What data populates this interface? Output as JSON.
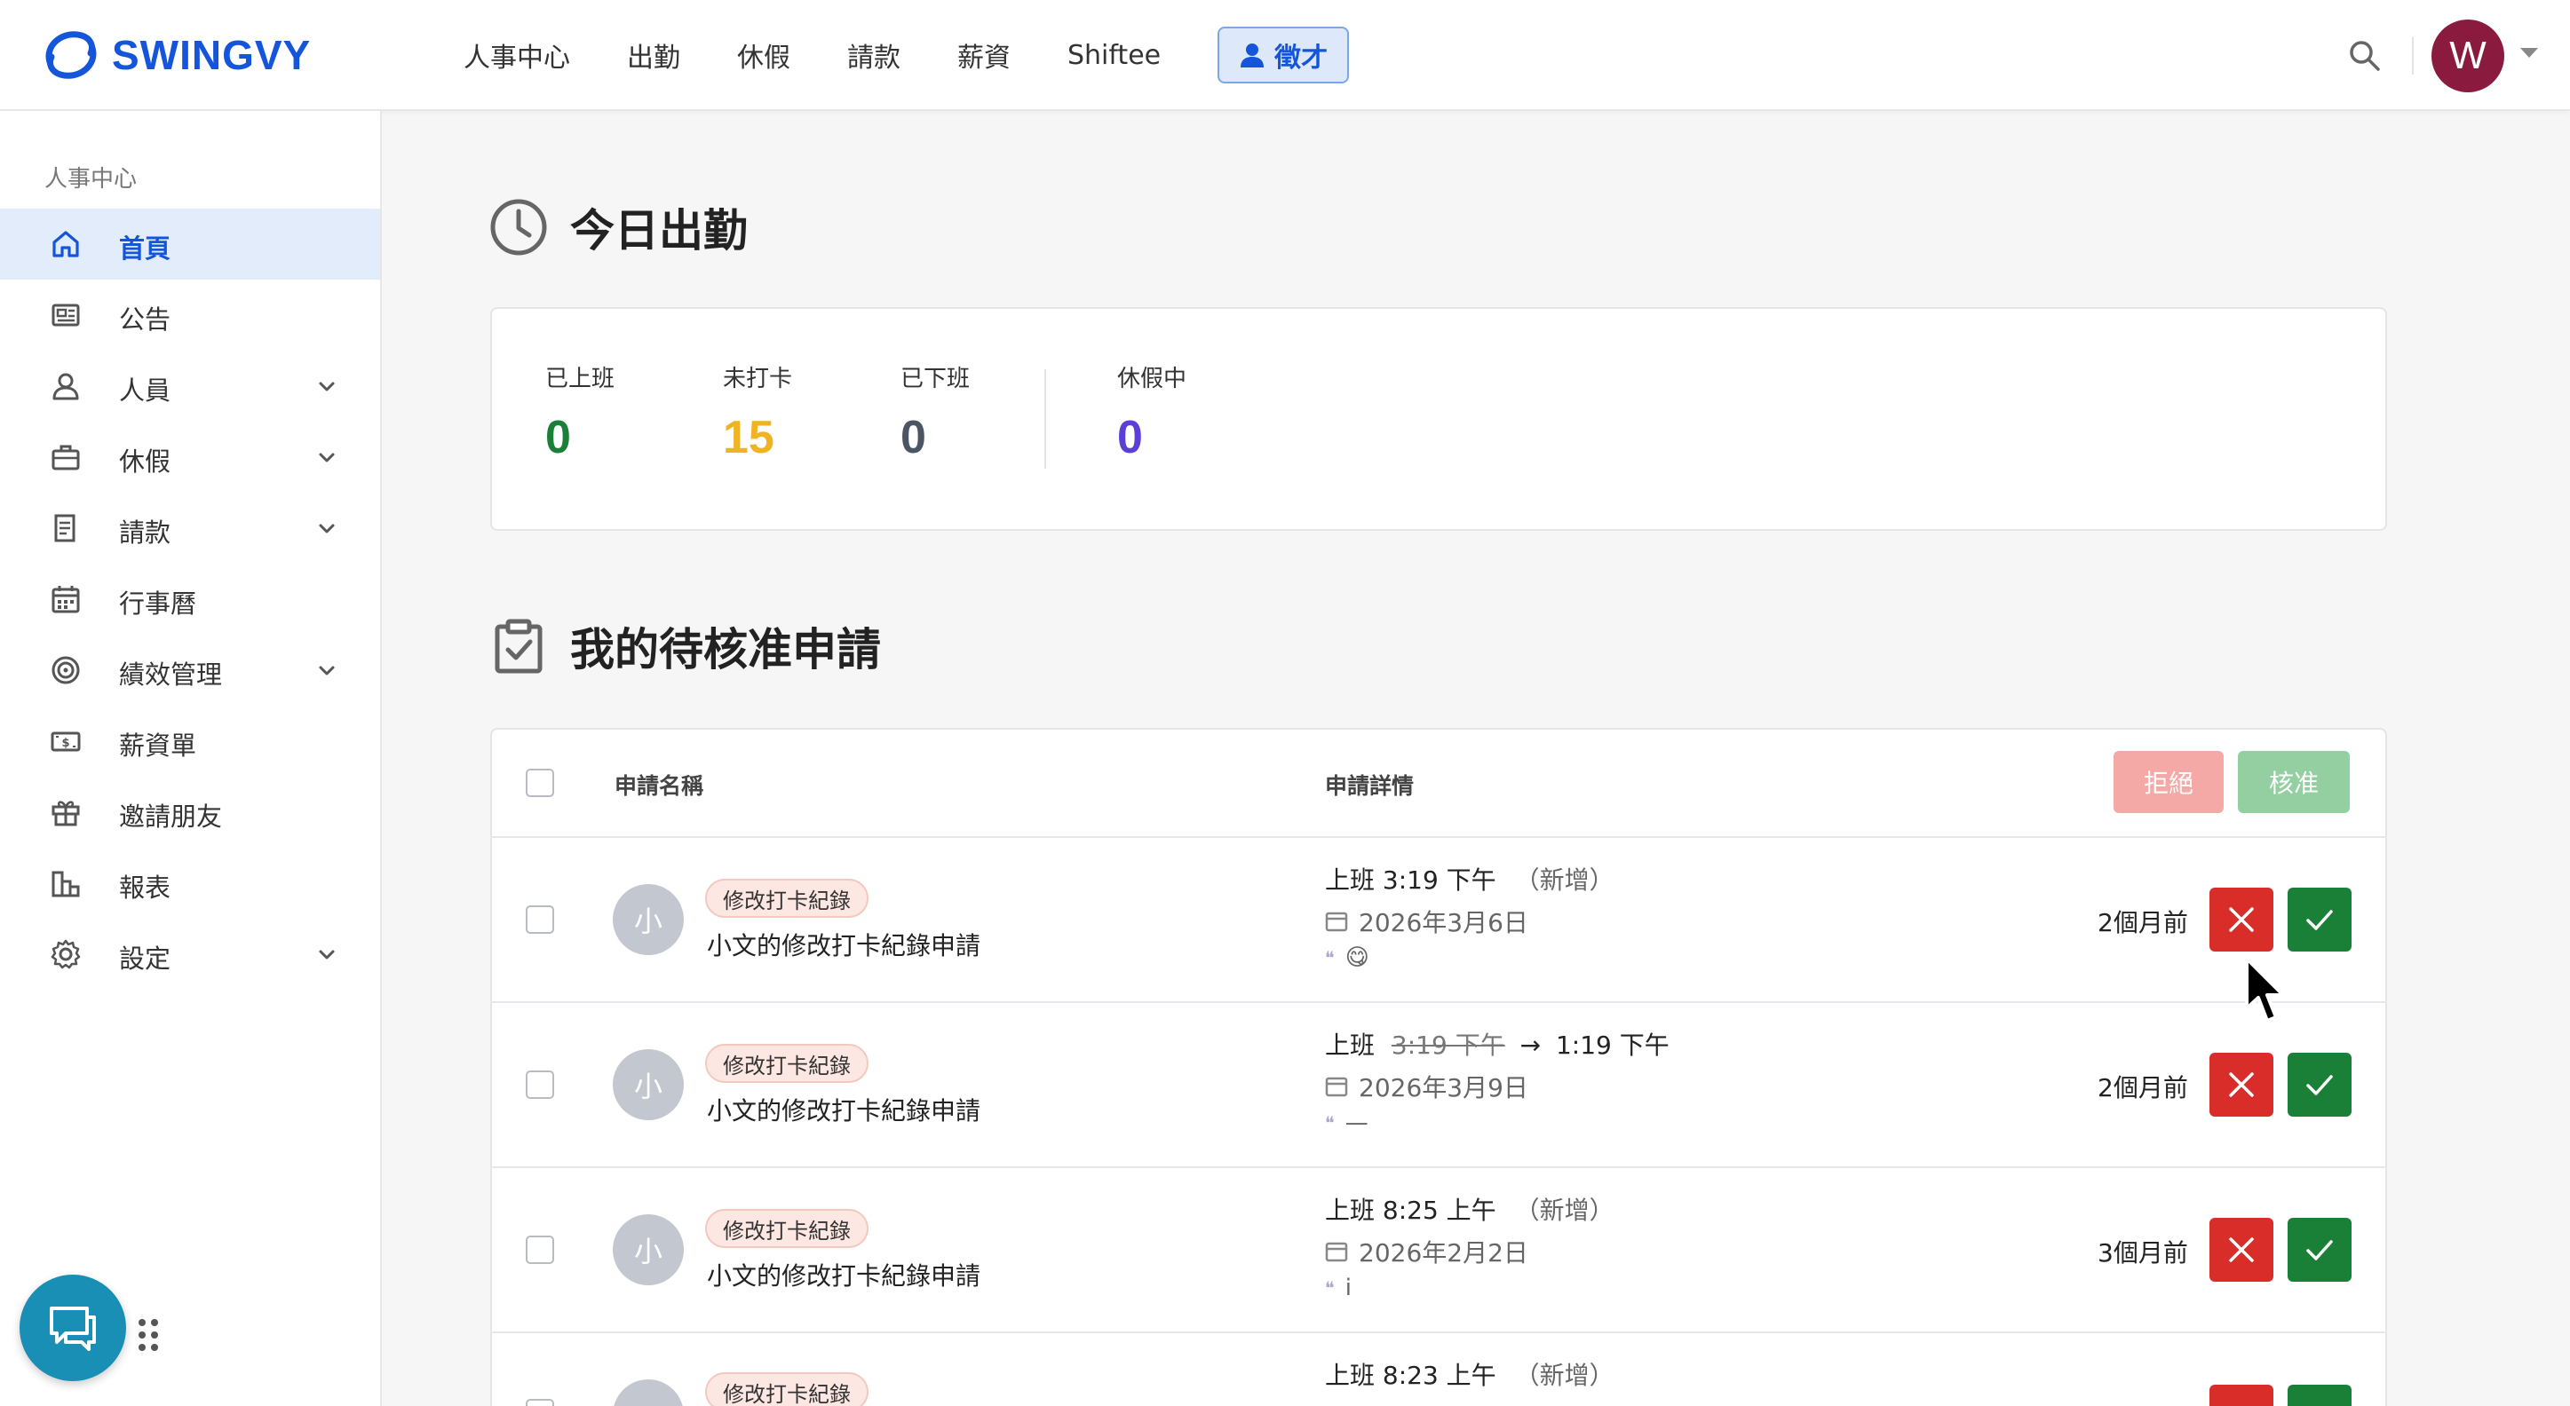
{
  "brand": {
    "name": "SWINGVY",
    "color": "#1455d9"
  },
  "topnav": {
    "items": [
      "人事中心",
      "出勤",
      "休假",
      "請款",
      "薪資",
      "Shiftee"
    ],
    "recruit_label": "徵才",
    "avatar_initial": "W"
  },
  "sidebar": {
    "heading": "人事中心",
    "items": [
      {
        "label": "首頁",
        "icon": "home-icon",
        "active": true
      },
      {
        "label": "公告",
        "icon": "newspaper-icon"
      },
      {
        "label": "人員",
        "icon": "person-icon",
        "expandable": true
      },
      {
        "label": "休假",
        "icon": "briefcase-icon",
        "expandable": true
      },
      {
        "label": "請款",
        "icon": "receipt-icon",
        "expandable": true
      },
      {
        "label": "行事曆",
        "icon": "calendar-icon"
      },
      {
        "label": "績效管理",
        "icon": "target-icon",
        "expandable": true
      },
      {
        "label": "薪資單",
        "icon": "money-icon"
      },
      {
        "label": "邀請朋友",
        "icon": "gift-icon"
      },
      {
        "label": "報表",
        "icon": "report-icon"
      },
      {
        "label": "設定",
        "icon": "gear-icon",
        "expandable": true
      }
    ]
  },
  "attendance": {
    "title": "今日出勤",
    "stats": [
      {
        "label": "已上班",
        "value": "0",
        "color": "#1a7f37"
      },
      {
        "label": "未打卡",
        "value": "15",
        "color": "#f0b323"
      },
      {
        "label": "已下班",
        "value": "0",
        "color": "#4b5563"
      },
      {
        "label": "休假中",
        "value": "0",
        "color": "#5b3fd6"
      }
    ]
  },
  "approvals": {
    "title": "我的待核准申請",
    "col_name": "申請名稱",
    "col_detail": "申請詳情",
    "reject_all": "拒絕",
    "approve_all": "核准",
    "rows": [
      {
        "avatar": "小",
        "tag": "修改打卡紀錄",
        "name": "小文的修改打卡紀錄申請",
        "detail_prefix": "上班 3:19 下午",
        "detail_old": "",
        "detail_arrow": "",
        "detail_new": "",
        "detail_note": "（新增）",
        "date": "2026年3月6日",
        "note": "😋",
        "ago": "2個月前"
      },
      {
        "avatar": "小",
        "tag": "修改打卡紀錄",
        "name": "小文的修改打卡紀錄申請",
        "detail_prefix": "上班",
        "detail_old": "3:19 下午",
        "detail_arrow": "→",
        "detail_new": "1:19 下午",
        "detail_note": "",
        "date": "2026年3月9日",
        "note": "—",
        "ago": "2個月前"
      },
      {
        "avatar": "小",
        "tag": "修改打卡紀錄",
        "name": "小文的修改打卡紀錄申請",
        "detail_prefix": "上班 8:25 上午",
        "detail_old": "",
        "detail_arrow": "",
        "detail_new": "",
        "detail_note": "（新增）",
        "date": "2026年2月2日",
        "note": "i",
        "ago": "3個月前"
      },
      {
        "avatar": "小",
        "tag": "修改打卡紀錄",
        "name": "",
        "detail_prefix": "上班 8:23 上午",
        "detail_old": "",
        "detail_arrow": "",
        "detail_new": "",
        "detail_note": "（新增）",
        "date": "",
        "note": "",
        "ago": ""
      }
    ]
  }
}
